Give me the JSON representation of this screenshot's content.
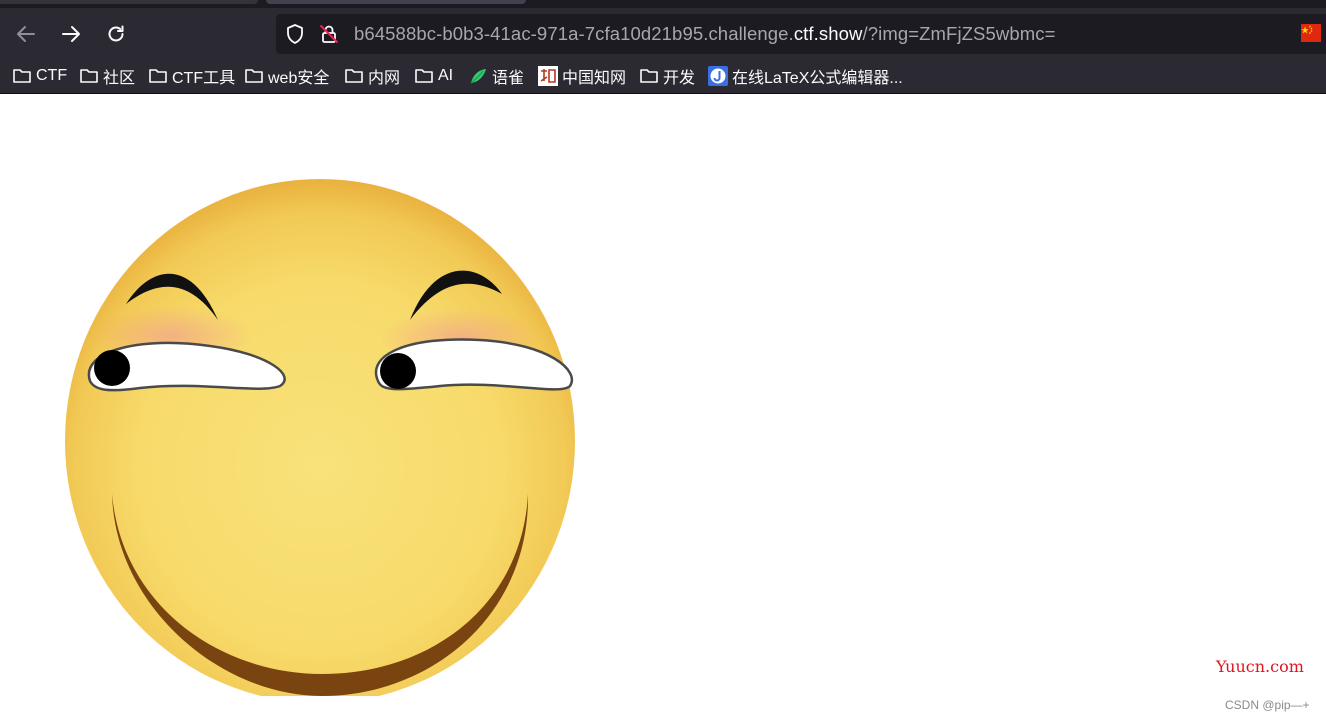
{
  "browser": {
    "url": {
      "prefix": "b64588bc-b0b3-41ac-971a-7cfa10d21b95.challenge.",
      "domain": "ctf.show",
      "suffix": "/?img=ZmFjZS5wbmc="
    },
    "bookmarks": [
      {
        "label": "CTF",
        "icon": "folder-icon"
      },
      {
        "label": "社区",
        "icon": "folder-icon"
      },
      {
        "label": "CTF工具",
        "icon": "folder-icon"
      },
      {
        "label": "web安全",
        "icon": "folder-icon"
      },
      {
        "label": "内网",
        "icon": "folder-icon"
      },
      {
        "label": "AI",
        "icon": "folder-icon"
      },
      {
        "label": "语雀",
        "icon": "yuque-icon"
      },
      {
        "label": "中国知网",
        "icon": "cnki-icon"
      },
      {
        "label": "开发",
        "icon": "folder-icon"
      },
      {
        "label": "在线LaTeX公式编辑器...",
        "icon": "latex-icon"
      }
    ],
    "colors": {
      "chrome_bg": "#2b2a33",
      "urlbar_bg": "#1c1b22",
      "text": "#fbfbfe",
      "url_dim": "#a6a6ad"
    }
  },
  "page": {
    "image": "smiley-face-image",
    "watermark": "Yuucn.com",
    "csdn_credit": "CSDN @pip—+"
  }
}
